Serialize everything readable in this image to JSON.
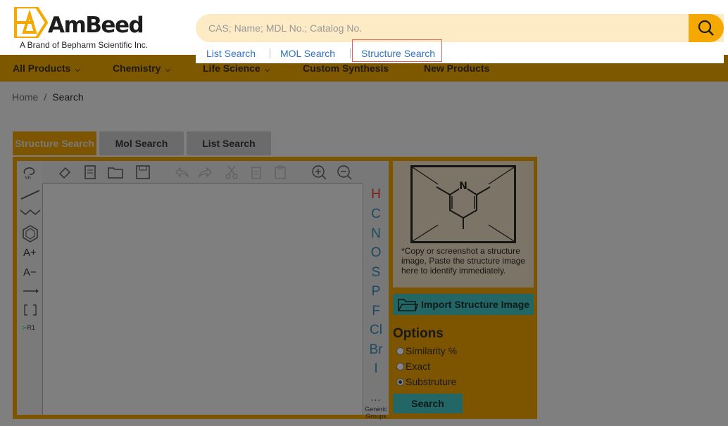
{
  "brand": {
    "name": "AmBeed",
    "tagline": "A Brand of Bepharm Scientific Inc.",
    "accent_color": "#f5a800"
  },
  "search": {
    "placeholder": "CAS; Name; MDL No.; Catalog No.",
    "button_icon": "magnifier-icon",
    "modes": [
      "List Search",
      "MOL Search",
      "Structure Search"
    ],
    "active_mode": "Structure Search"
  },
  "nav": {
    "items": [
      "All Products",
      "Chemistry",
      "Life Science",
      "Custom Synthesis",
      "New Products"
    ]
  },
  "breadcrumb": {
    "home": "Home",
    "separator": "/",
    "current": "Search"
  },
  "tabs": [
    "Structure Search",
    "Mol Search",
    "List Search"
  ],
  "editor": {
    "left_tools": [
      "A+",
      "A−",
      "R1"
    ],
    "atoms": [
      "H",
      "C",
      "N",
      "O",
      "S",
      "P",
      "F",
      "Cl",
      "Br",
      "I"
    ],
    "more": "...",
    "generic_groups": "Generic Groups"
  },
  "preview": {
    "atom_label": "N",
    "note": "*Copy or screenshot a structure image, Paste the structure image here to identify immediately."
  },
  "import_button": "Import Structure Image",
  "options": {
    "title": "Options",
    "items": [
      "Similarity %",
      "Exact",
      "Substruture"
    ],
    "selected": "Substruture"
  },
  "search_button": "Search",
  "colors": {
    "overlay": "#7f7f7f",
    "link": "#2f72c4",
    "teal_button": "#236666"
  }
}
